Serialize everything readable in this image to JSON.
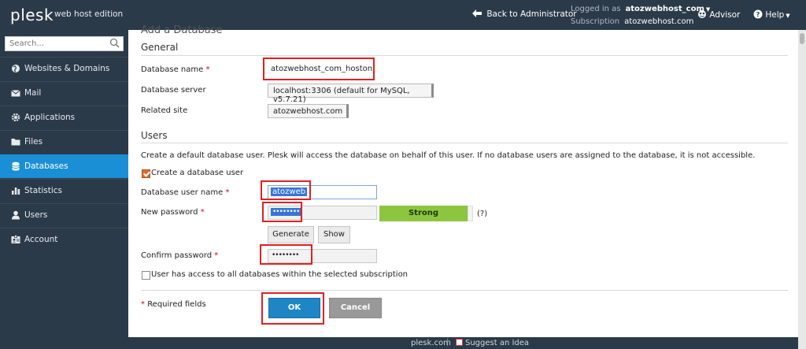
{
  "topbar": {
    "logo": "plesk",
    "logo_sub": "web host edition",
    "back_to_admin": "Back to Administrator",
    "logged_in_label": "Logged in as",
    "logged_in_value": "atozwebhost_com",
    "subscription_label": "Subscription",
    "subscription_value": "atozwebhost.com",
    "advisor": "Advisor",
    "help": "Help"
  },
  "sidebar": {
    "search_placeholder": "Search...",
    "items": [
      {
        "label": "Websites & Domains",
        "icon": "globe-icon"
      },
      {
        "label": "Mail",
        "icon": "envelope-icon"
      },
      {
        "label": "Applications",
        "icon": "gear-icon"
      },
      {
        "label": "Files",
        "icon": "folder-icon"
      },
      {
        "label": "Databases",
        "icon": "database-icon",
        "active": true
      },
      {
        "label": "Statistics",
        "icon": "bar-chart-icon"
      },
      {
        "label": "Users",
        "icon": "user-icon"
      },
      {
        "label": "Account",
        "icon": "id-card-icon"
      }
    ]
  },
  "form": {
    "cut_title": "Add a Database",
    "general_title": "General",
    "db_name_label": "Database name",
    "db_name_value": "atozwebhost_com_hoston",
    "db_server_label": "Database server",
    "db_server_value": "localhost:3306 (default for MySQL, v5.7.21)",
    "related_site_label": "Related site",
    "related_site_value": "atozwebhost.com",
    "users_title": "Users",
    "users_desc": "Create a default database user. Plesk will access the database on behalf of this user. If no database users are assigned to the database, it is not accessible.",
    "create_user_label": "Create a database user",
    "db_user_label": "Database user name",
    "db_user_value": "atozweb",
    "new_password_label": "New password",
    "new_password_value": "••••••••",
    "strength": "Strong",
    "help_mark": "(?)",
    "generate": "Generate",
    "show": "Show",
    "confirm_password_label": "Confirm password",
    "confirm_password_value": "••••••••",
    "access_all_label": "User has access to all databases within the selected subscription",
    "required_note": "Required fields",
    "ok": "OK",
    "cancel": "Cancel",
    "asterisk": "*"
  },
  "footer": {
    "link": "plesk.com",
    "separator": "|",
    "suggest": "Suggest an Idea"
  },
  "colors": {
    "topbar": "#2b3a49",
    "active_nav": "#1a8fd6",
    "strength_bar": "#8cc63f",
    "ok_button": "#1e86c5",
    "cancel_button": "#999999",
    "annotation_red": "#e02020"
  }
}
